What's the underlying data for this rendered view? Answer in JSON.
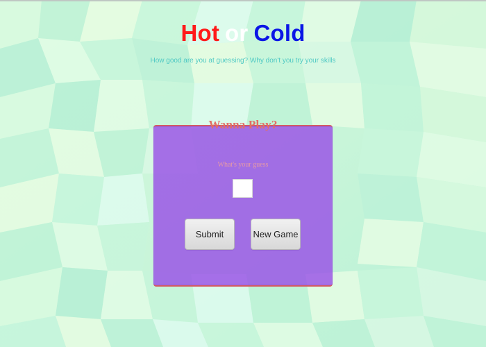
{
  "header": {
    "title_part1": "Hot",
    "title_part2": "or",
    "title_part3": "Cold",
    "subtitle": "How good are you at guessing? Why don't you try your skills"
  },
  "game": {
    "card_title": "Wanna Play?",
    "prompt": "What's your guess",
    "guess_value": "",
    "guess_placeholder": ""
  },
  "buttons": {
    "submit_label": "Submit",
    "new_game_label": "New Game"
  },
  "colors": {
    "hot": "#ff1a1a",
    "or": "#ffffff",
    "cold": "#0b16e6",
    "subtitle": "#49c7c3",
    "card_bg": "#9d55e6",
    "card_title": "#e26e64",
    "card_border": "#d25b66"
  }
}
